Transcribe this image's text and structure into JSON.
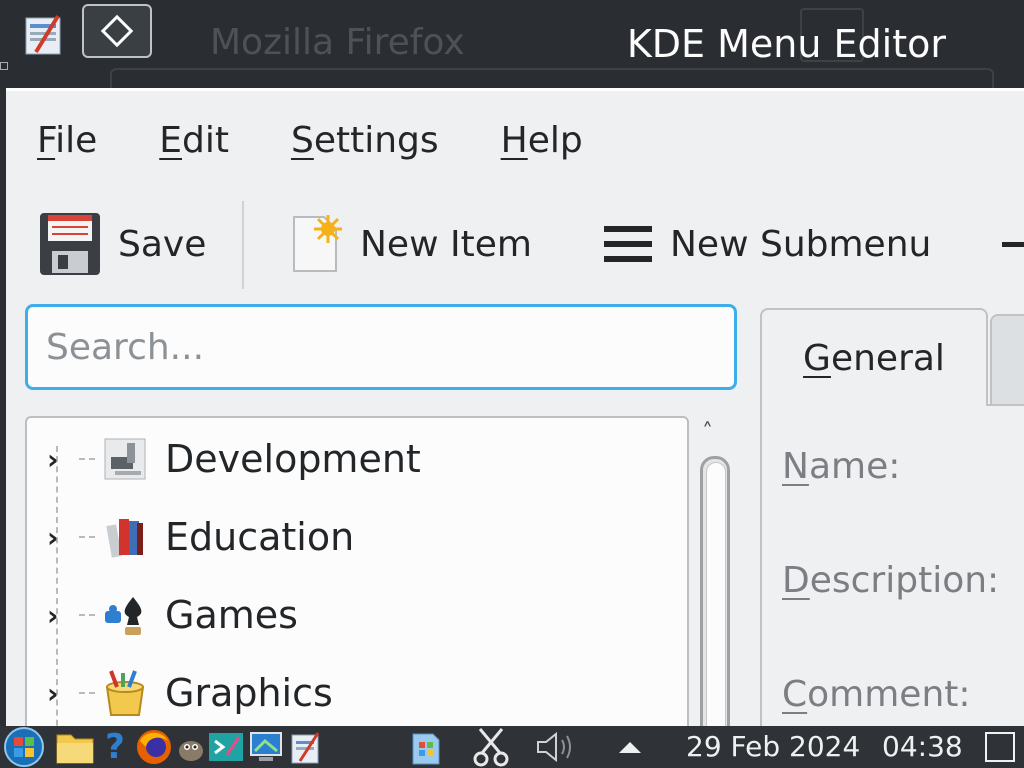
{
  "titlebar": {
    "title": "KDE Menu Editor",
    "background_window_title": "Mozilla Firefox"
  },
  "menubar": {
    "items": [
      {
        "label": "File",
        "mnemonic": "F",
        "rest": "ile"
      },
      {
        "label": "Edit",
        "mnemonic": "E",
        "rest": "dit"
      },
      {
        "label": "Settings",
        "mnemonic": "S",
        "rest": "ettings"
      },
      {
        "label": "Help",
        "mnemonic": "H",
        "rest": "elp"
      }
    ]
  },
  "toolbar": {
    "save_label": "Save",
    "new_item_label": "New Item",
    "new_submenu_label": "New Submenu"
  },
  "search": {
    "placeholder": "Search..."
  },
  "tree": {
    "items": [
      {
        "label": "Development",
        "icon": "development-icon"
      },
      {
        "label": "Education",
        "icon": "education-icon"
      },
      {
        "label": "Games",
        "icon": "games-icon"
      },
      {
        "label": "Graphics",
        "icon": "graphics-icon"
      }
    ]
  },
  "details": {
    "tab_general": {
      "mnemonic": "G",
      "rest": "eneral"
    },
    "fields": [
      {
        "mnemonic": "N",
        "rest": "ame:"
      },
      {
        "mnemonic": "D",
        "rest": "escription:"
      },
      {
        "mnemonic": "C",
        "rest": "omment:"
      }
    ]
  },
  "taskbar": {
    "date": "29 Feb 2024",
    "time": "04:38"
  },
  "colors": {
    "accent": "#3daee9",
    "window_bg": "#eff0f1",
    "titlebar_bg": "#2a2e32",
    "text": "#232629"
  }
}
